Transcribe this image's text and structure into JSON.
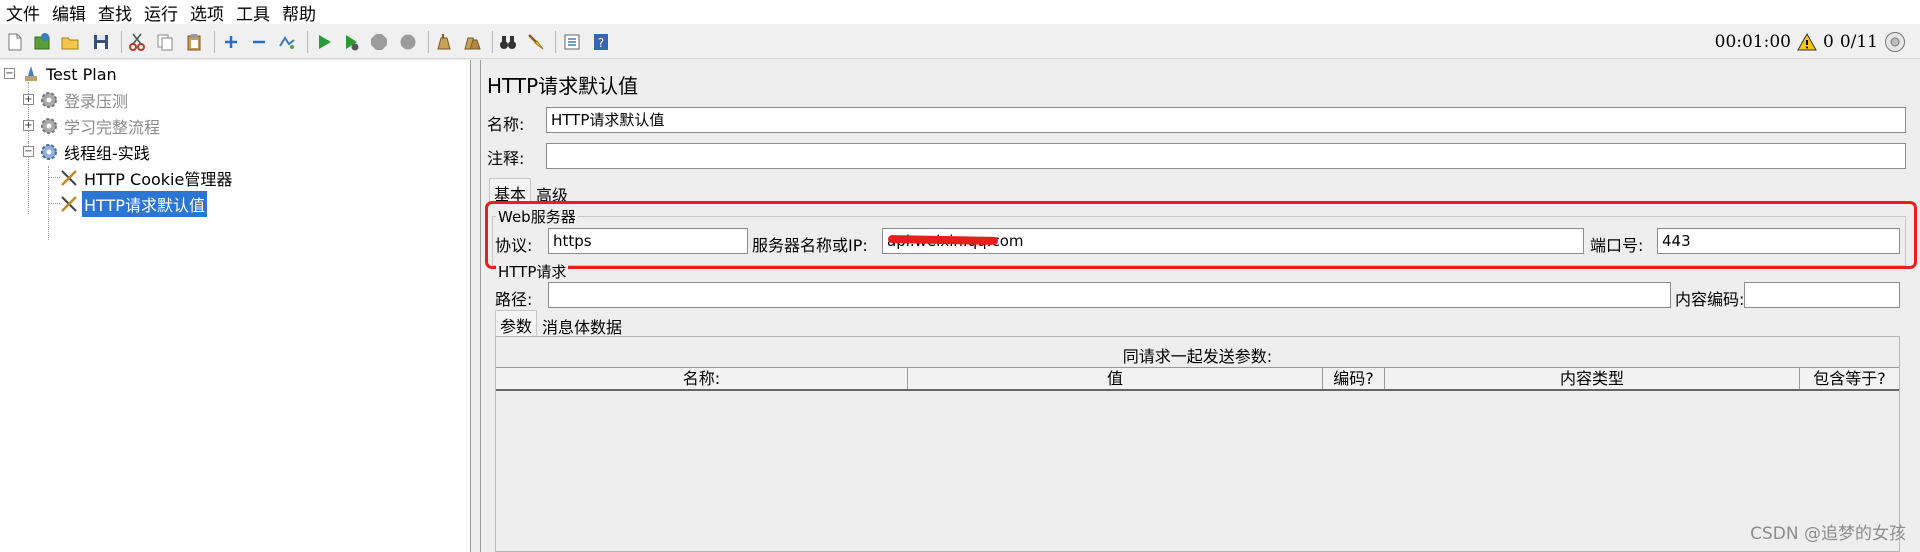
{
  "menu": [
    "文件",
    "编辑",
    "查找",
    "运行",
    "选项",
    "工具",
    "帮助"
  ],
  "toolbar": {
    "timer": "00:01:00",
    "warning_count": "0",
    "threads": "0/11"
  },
  "tree": {
    "items": [
      {
        "label": "Test Plan",
        "icon": "test-plan-icon",
        "state": "normal"
      },
      {
        "label": "登录压测",
        "icon": "gear-icon",
        "state": "disabled"
      },
      {
        "label": "学习完整流程",
        "icon": "gear-icon",
        "state": "disabled"
      },
      {
        "label": "线程组-实践",
        "icon": "gear-icon",
        "state": "normal"
      },
      {
        "label": "HTTP Cookie管理器",
        "icon": "tools-icon",
        "state": "normal"
      },
      {
        "label": "HTTP请求默认值",
        "icon": "tools-icon",
        "state": "selected"
      }
    ]
  },
  "panel": {
    "title": "HTTP请求默认值",
    "name_label": "名称:",
    "name_value": "HTTP请求默认值",
    "comment_label": "注释:",
    "comment_value": "",
    "tabs": [
      "基本",
      "高级"
    ],
    "web_server": {
      "title": "Web服务器",
      "protocol_label": "协议:",
      "protocol_value": "https",
      "server_label": "服务器名称或IP:",
      "server_value": "api.weixin.qq.com",
      "port_label": "端口号:",
      "port_value": "443"
    },
    "http_request": {
      "title": "HTTP请求",
      "path_label": "路径:",
      "path_value": "",
      "encoding_label": "内容编码:",
      "encoding_value": ""
    },
    "sub_tabs": [
      "参数",
      "消息体数据"
    ],
    "params_table": {
      "caption": "同请求一起发送参数:",
      "columns": [
        "名称:",
        "值",
        "编码?",
        "内容类型",
        "包含等于?"
      ]
    }
  },
  "watermark": "CSDN @追梦的女孩",
  "colors": {
    "selection": "#2a76d2",
    "highlight": "#ea1d1d"
  }
}
